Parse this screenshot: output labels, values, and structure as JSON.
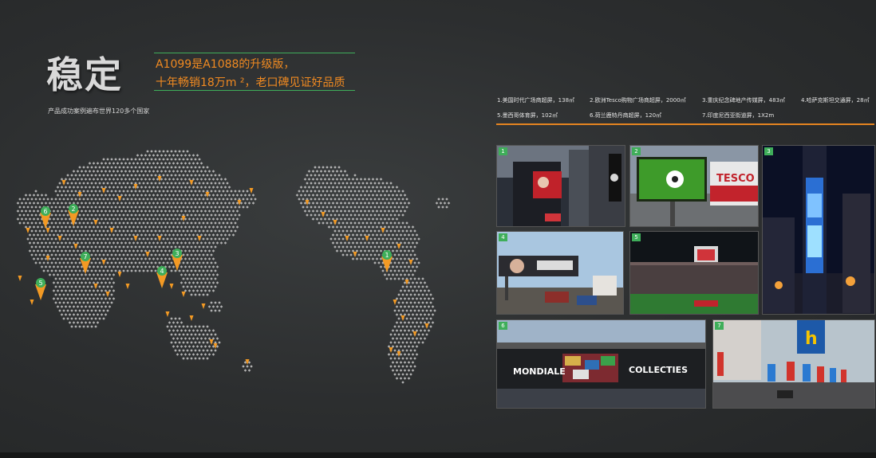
{
  "title": "稳定",
  "subtitle": "产品成功案例遍布世界120多个国家",
  "slogan": {
    "line1": "A1099是A1088的升级版，",
    "line2": "十年畅销18万m ²，老口碑见证好品质"
  },
  "legend": {
    "row1": [
      "1.美国时代广场商超屏，138㎡",
      "2.欧洲Tesco购物广场商超屏，2000㎡",
      "3.重庆纪念碑地产传媒屏，483㎡",
      "4.哈萨克斯坦交通屏，28㎡"
    ],
    "row2": [
      "5.墨西哥体育屏，102㎡",
      "6.荷兰鹿特丹商超屏，120㎡",
      "7.印度尼西亚街道屏，1X2m"
    ]
  },
  "photos": [
    {
      "number": "1",
      "scene": "times-square-billboard"
    },
    {
      "number": "2",
      "scene": "tesco-soccer-screen"
    },
    {
      "number": "3",
      "scene": "chongqing-tower-screen"
    },
    {
      "number": "4",
      "scene": "kazakhstan-street-billboard"
    },
    {
      "number": "5",
      "scene": "mexico-stadium-screen"
    },
    {
      "number": "6",
      "scene": "rotterdam-mall-screen",
      "sign_left": "MONDIALE",
      "sign_right": "COLLECTIES"
    },
    {
      "number": "7",
      "scene": "indonesia-street-screens"
    }
  ],
  "photo2_sign": "TESCO",
  "map_markers": [
    "1",
    "2",
    "3",
    "4",
    "5",
    "6",
    "7"
  ],
  "colors": {
    "accent": "#f08a21",
    "rule": "#3fae5a",
    "marker": "#f39a24",
    "dot": "#c9c9c9"
  }
}
